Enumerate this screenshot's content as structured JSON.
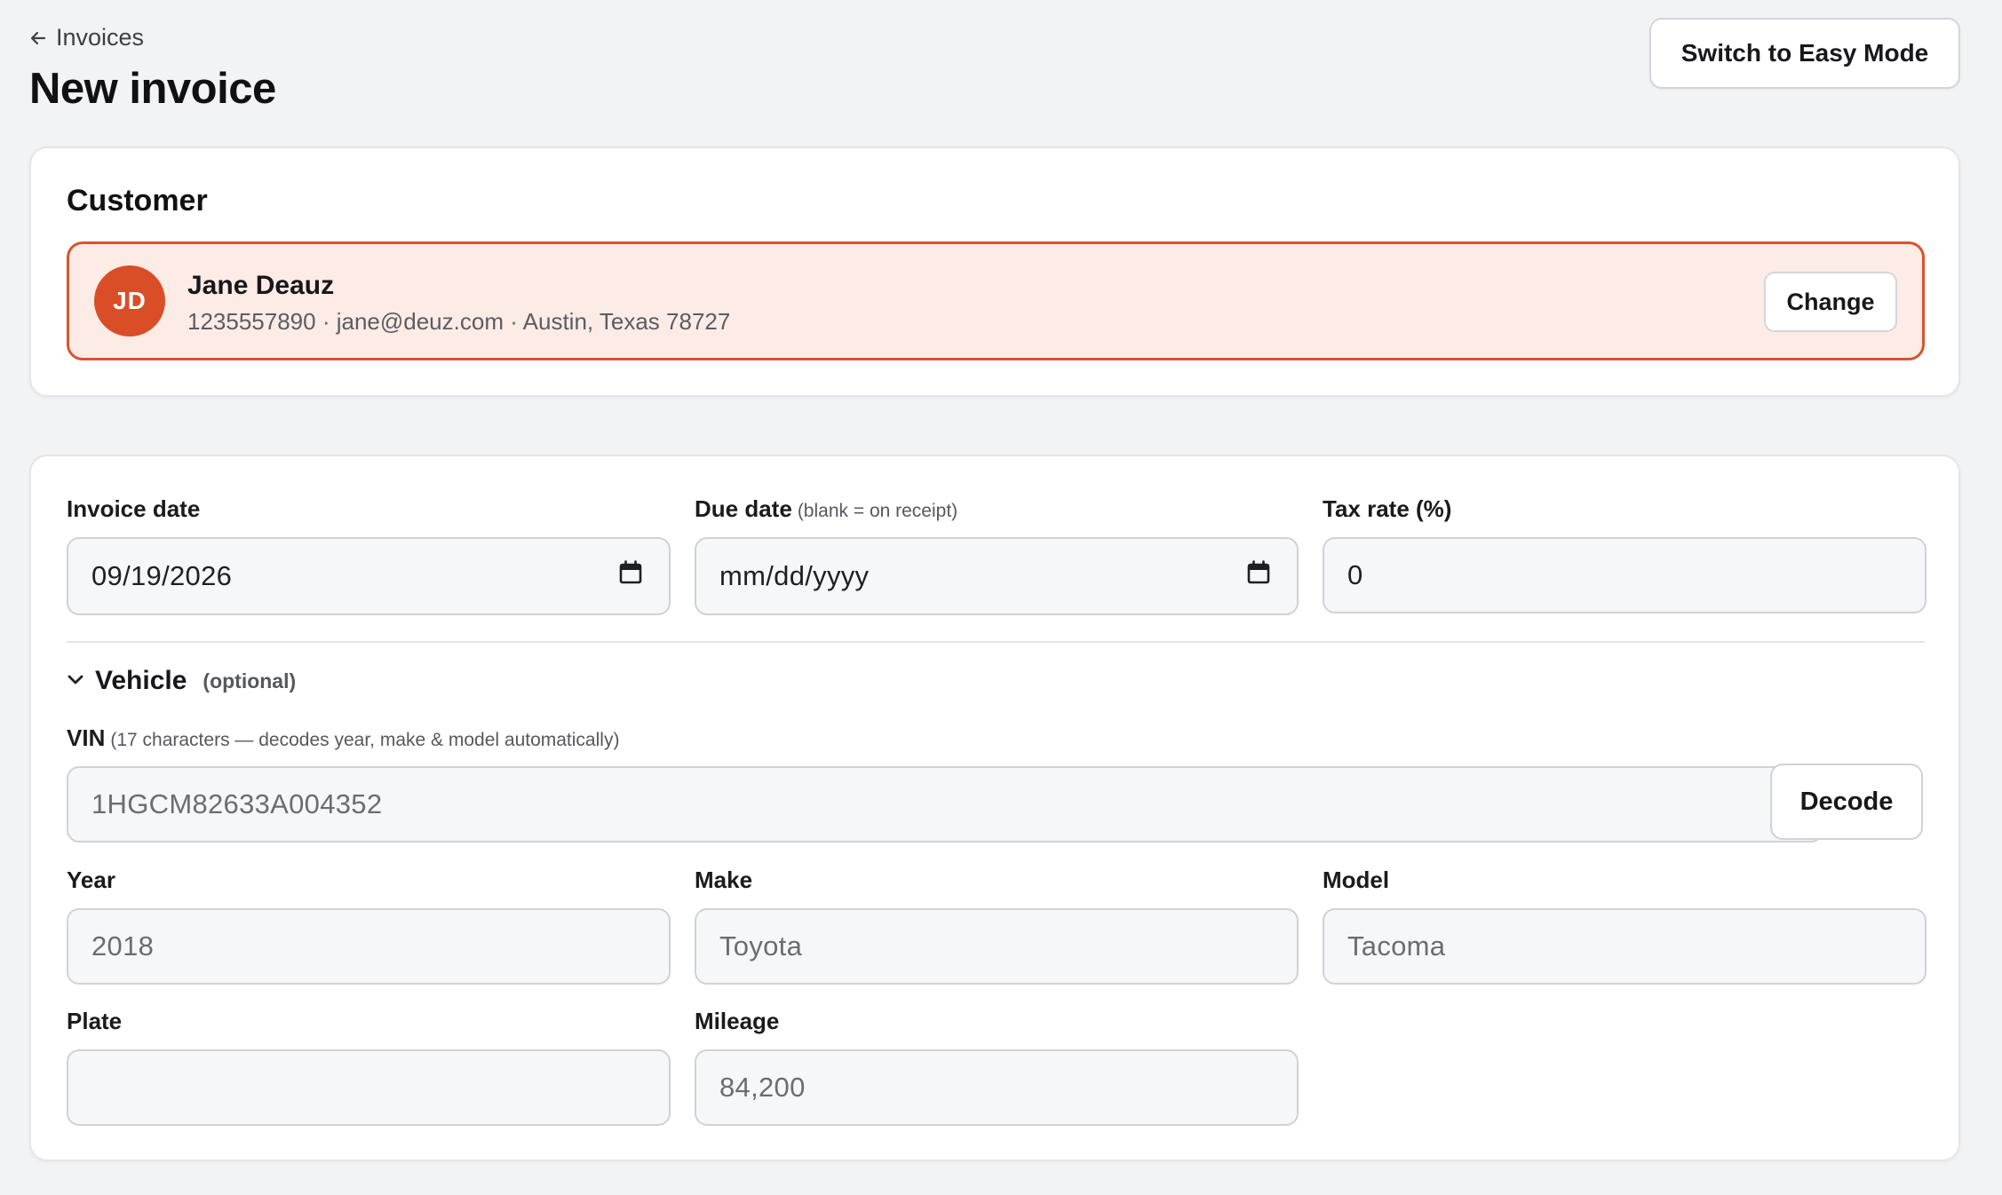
{
  "header": {
    "back_label": "Invoices",
    "title": "New invoice",
    "easy_mode_label": "Switch to Easy Mode"
  },
  "customer": {
    "section_title": "Customer",
    "initials": "JD",
    "name": "Jane Deauz",
    "details": "1235557890 · jane@deuz.com · Austin, Texas 78727",
    "change_label": "Change"
  },
  "invoice": {
    "invoice_date_label": "Invoice date",
    "invoice_date_value": "09/19/2026",
    "due_date_label": "Due date",
    "due_date_hint": "(blank = on receipt)",
    "due_date_placeholder": "mm/dd/yyyy",
    "tax_rate_label": "Tax rate (%)",
    "tax_rate_value": "0"
  },
  "vehicle": {
    "title": "Vehicle",
    "optional_label": "(optional)",
    "vin_label": "VIN",
    "vin_hint": "(17 characters — decodes year, make & model automatically)",
    "vin_value": "1HGCM82633A004352",
    "decode_label": "Decode",
    "year_label": "Year",
    "year_value": "2018",
    "make_label": "Make",
    "make_value": "Toyota",
    "model_label": "Model",
    "model_value": "Tacoma",
    "plate_label": "Plate",
    "plate_value": "",
    "mileage_label": "Mileage",
    "mileage_value": "84,200"
  },
  "colors": {
    "accent": "#d9542c",
    "accent_bg": "#fdebe6",
    "page_bg": "#f2f3f5"
  }
}
